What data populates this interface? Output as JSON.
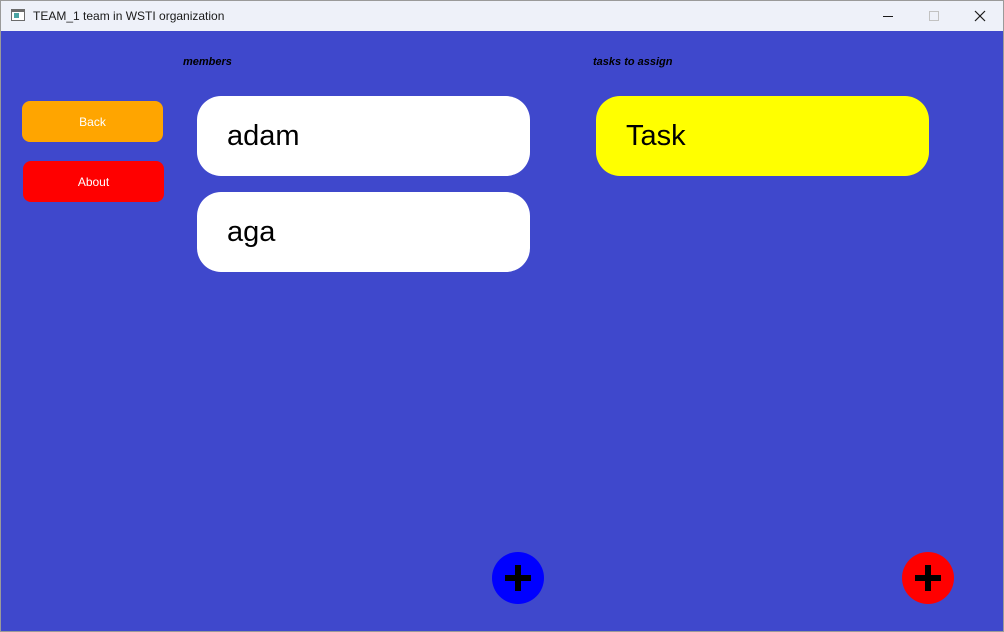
{
  "window": {
    "title": "TEAM_1 team in WSTI organization"
  },
  "colors": {
    "background": "#3f48cc",
    "back_button": "#ffa500",
    "about_button": "#ff0000",
    "member_card": "#ffffff",
    "task_card": "#ffff00",
    "add_member_fab": "#0000ff",
    "add_task_fab": "#ff0000"
  },
  "nav": {
    "back_label": "Back",
    "about_label": "About"
  },
  "members": {
    "heading": "members",
    "items": [
      "adam",
      "aga"
    ]
  },
  "tasks": {
    "heading": "tasks to assign",
    "items": [
      "Task"
    ]
  },
  "icons": {
    "add_member": "plus-icon",
    "add_task": "plus-icon"
  }
}
